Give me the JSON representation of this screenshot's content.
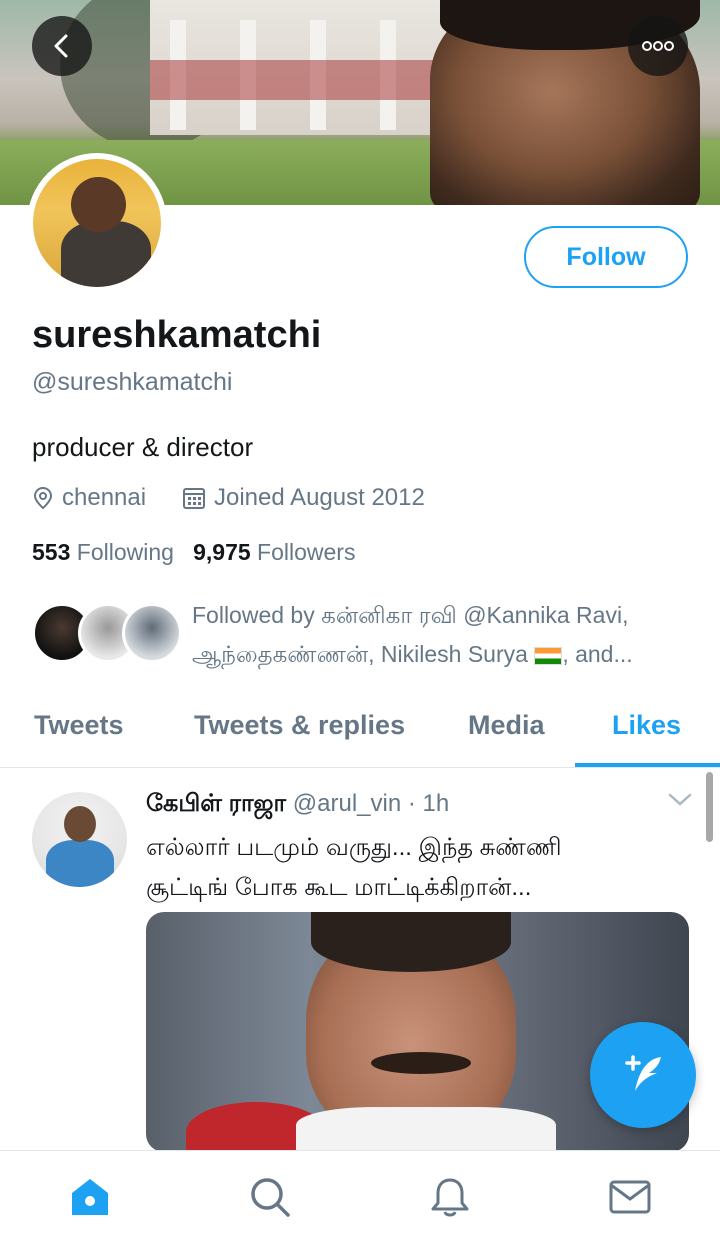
{
  "profile": {
    "display_name": "sureshkamatchi",
    "handle": "@sureshkamatchi",
    "bio": "producer & director",
    "location": "chennai",
    "joined": "Joined August 2012",
    "following_count": "553",
    "following_label": "Following",
    "followers_count": "9,975",
    "followers_label": "Followers",
    "followed_by_prefix": "Followed by கன்னிகா ரவி @Kannika Ravi,",
    "followed_by_line2": "ஆந்தைகண்ணன், Nikilesh Surya",
    "followed_by_suffix": ", and..."
  },
  "actions": {
    "follow_label": "Follow"
  },
  "tabs": [
    {
      "label": "Tweets",
      "active": false
    },
    {
      "label": "Tweets & replies",
      "active": false
    },
    {
      "label": "Media",
      "active": false
    },
    {
      "label": "Likes",
      "active": true
    }
  ],
  "tweet": {
    "author_name": "கேபிள் ராஜா",
    "author_handle": "@arul_vin",
    "time": "· 1h",
    "text_line1": "எல்லார் படமும் வருது... இந்த சுண்ணி",
    "text_line2": "சூட்டிங் போக கூட மாட்டிக்கிறான்..."
  },
  "icons": {
    "back": "back-arrow-icon",
    "more": "more-options-icon",
    "location": "location-pin-icon",
    "calendar": "calendar-icon",
    "chevron": "chevron-down-icon",
    "compose": "compose-tweet-icon",
    "home": "home-icon",
    "search": "search-icon",
    "notifications": "bell-icon",
    "messages": "mail-icon",
    "flag": "india-flag-emoji"
  },
  "colors": {
    "accent": "#1da1f2",
    "secondary_text": "#657786",
    "primary_text": "#14171a"
  }
}
